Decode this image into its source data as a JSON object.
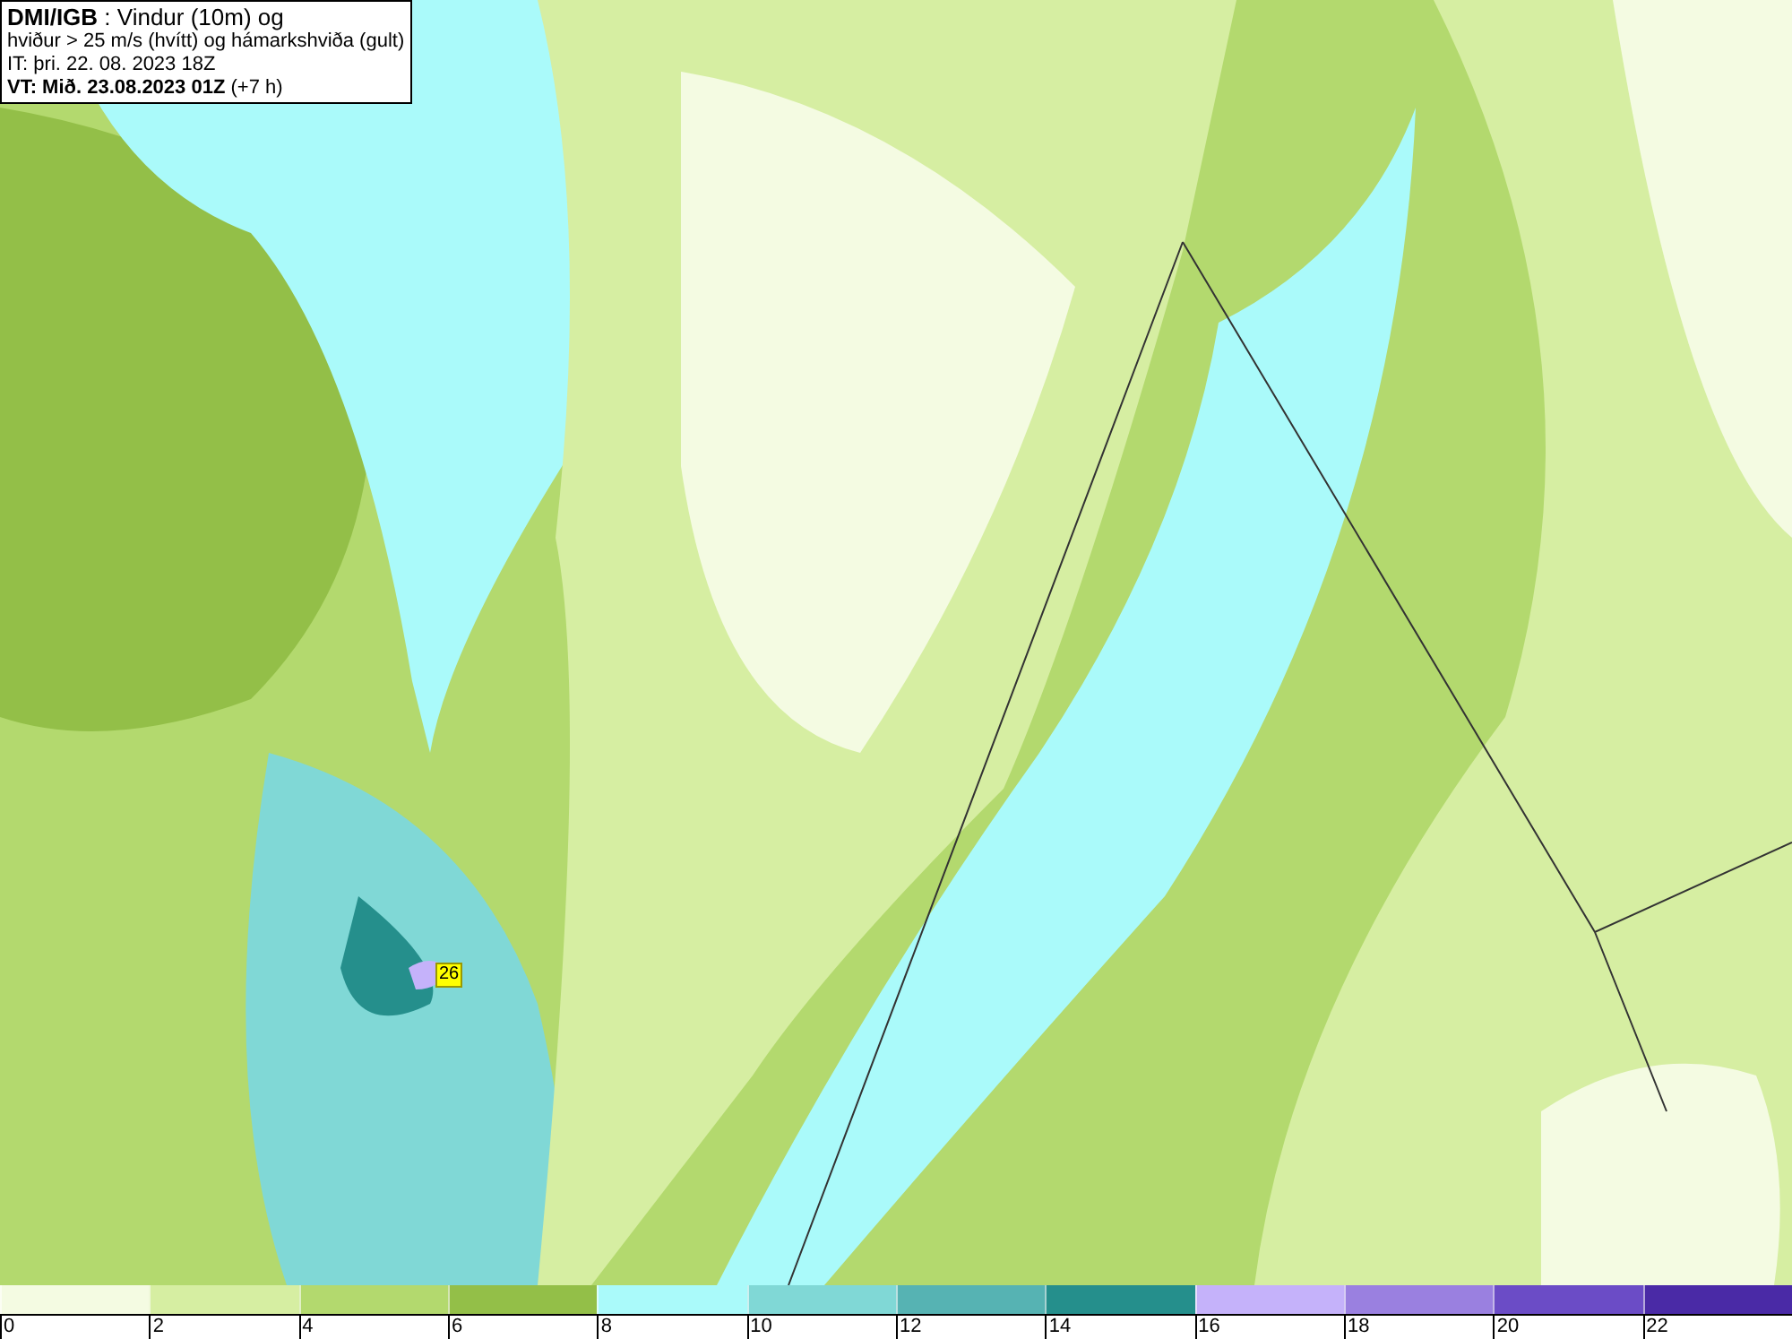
{
  "header": {
    "lines": [
      "**DMI/IGB** : Vindur (10m) og",
      "hviður > 25 m/s (hvítt) og hámarkshviða (gult)",
      "IT: þri. 22. 08. 2023 18Z",
      "**VT: Mið. 23.08.2023 01Z** (+7 h)"
    ]
  },
  "map": {
    "gust_label": "26"
  },
  "legend": {
    "segments": [
      {
        "color": "#f4fbe2"
      },
      {
        "color": "#d6eea2"
      },
      {
        "color": "#b3d96e"
      },
      {
        "color": "#93bf48"
      },
      {
        "color": "#aafafa"
      },
      {
        "color": "#80d8d6"
      },
      {
        "color": "#56b3b3"
      },
      {
        "color": "#258f8c"
      },
      {
        "color": "#c5b2fa"
      },
      {
        "color": "#9a80e0"
      },
      {
        "color": "#6b4cc6"
      },
      {
        "color": "#4a2aa6"
      }
    ],
    "labels": [
      "0",
      "2",
      "4",
      "6",
      "8",
      "10",
      "12",
      "14",
      "16",
      "18",
      "20",
      "22"
    ]
  }
}
